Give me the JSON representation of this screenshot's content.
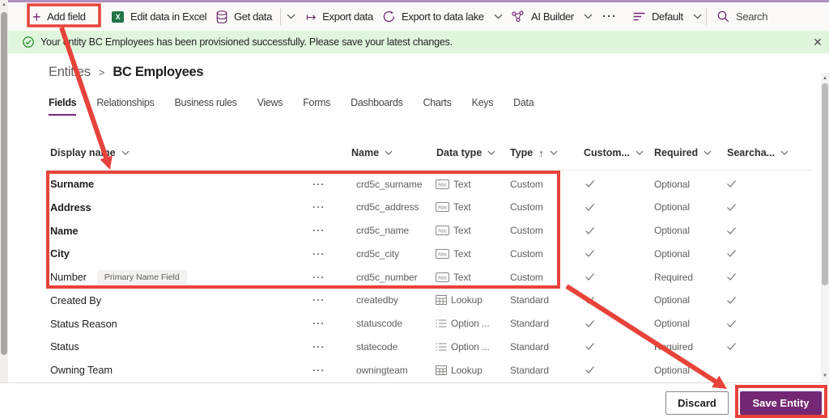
{
  "toolbar": {
    "add_field": "Add field",
    "edit_excel": "Edit data in Excel",
    "get_data": "Get data",
    "export_data": "Export data",
    "export_lake": "Export to data lake",
    "ai_builder": "AI Builder",
    "view_selector": "Default",
    "search_placeholder": "Search"
  },
  "icons": {
    "plus": "+",
    "more": "···",
    "export_arrow": "↦",
    "close": "✕",
    "row_more": "···",
    "sort_up": "↑"
  },
  "notification": {
    "message": "Your entity BC Employees has been provisioned successfully. Please save your latest changes."
  },
  "breadcrumb": {
    "parent": "Entities",
    "separator": ">",
    "current": "BC Employees"
  },
  "tabs": [
    "Fields",
    "Relationships",
    "Business rules",
    "Views",
    "Forms",
    "Dashboards",
    "Charts",
    "Keys",
    "Data"
  ],
  "active_tab": "Fields",
  "table": {
    "headers": {
      "display_name": "Display name",
      "name": "Name",
      "data_type": "Data type",
      "type": "Type",
      "custom": "Custom...",
      "required": "Required",
      "searchable": "Searcha..."
    },
    "rows": [
      {
        "display": "Surname",
        "bold": true,
        "badge": "",
        "name": "crd5c_surname",
        "dtype": "Text",
        "dicon": "text",
        "type": "Custom",
        "custom_check": true,
        "required": "Optional",
        "searchable": true
      },
      {
        "display": "Address",
        "bold": true,
        "badge": "",
        "name": "crd5c_address",
        "dtype": "Text",
        "dicon": "text",
        "type": "Custom",
        "custom_check": true,
        "required": "Optional",
        "searchable": true
      },
      {
        "display": "Name",
        "bold": true,
        "badge": "",
        "name": "crd5c_name",
        "dtype": "Text",
        "dicon": "text",
        "type": "Custom",
        "custom_check": true,
        "required": "Optional",
        "searchable": true
      },
      {
        "display": "City",
        "bold": true,
        "badge": "",
        "name": "crd5c_city",
        "dtype": "Text",
        "dicon": "text",
        "type": "Custom",
        "custom_check": true,
        "required": "Optional",
        "searchable": true
      },
      {
        "display": "Number",
        "bold": false,
        "badge": "Primary Name Field",
        "name": "crd5c_number",
        "dtype": "Text",
        "dicon": "text",
        "type": "Custom",
        "custom_check": true,
        "required": "Required",
        "searchable": true
      },
      {
        "display": "Created By",
        "bold": false,
        "badge": "",
        "name": "createdby",
        "dtype": "Lookup",
        "dicon": "lookup",
        "type": "Standard",
        "custom_check": true,
        "required": "Optional",
        "searchable": true
      },
      {
        "display": "Status Reason",
        "bold": false,
        "badge": "",
        "name": "statuscode",
        "dtype": "Option ...",
        "dicon": "option",
        "type": "Standard",
        "custom_check": true,
        "required": "Optional",
        "searchable": true
      },
      {
        "display": "Status",
        "bold": false,
        "badge": "",
        "name": "statecode",
        "dtype": "Option ...",
        "dicon": "option",
        "type": "Standard",
        "custom_check": true,
        "required": "Required",
        "searchable": true
      },
      {
        "display": "Owning Team",
        "bold": false,
        "badge": "",
        "name": "owningteam",
        "dtype": "Lookup",
        "dicon": "lookup",
        "type": "Standard",
        "custom_check": true,
        "required": "Optional",
        "searchable": false
      }
    ]
  },
  "footer": {
    "discard": "Discard",
    "save": "Save Entity"
  },
  "colors": {
    "accent": "#742774",
    "annotation_red": "#e8433a",
    "notification_green": "#dff6dd",
    "success_icon": "#107c10"
  }
}
